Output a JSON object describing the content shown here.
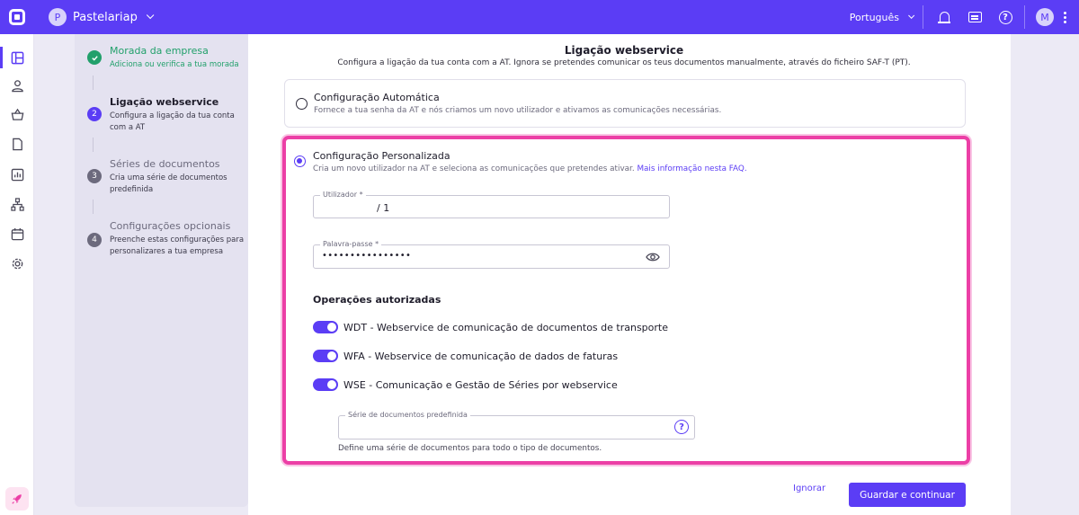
{
  "header": {
    "company_initial": "P",
    "company_name": "Pastelariap",
    "language": "Português",
    "user_initial": "M",
    "icons": [
      "app-logo",
      "bell-icon",
      "chat-icon",
      "help-icon",
      "more-vertical-icon"
    ]
  },
  "sidebar": {
    "icons": [
      "dashboard-icon",
      "user-icon",
      "basket-icon",
      "document-icon",
      "chart-icon",
      "sitemap-icon",
      "calendar-icon",
      "settings-icon",
      "rocket-icon"
    ]
  },
  "steps": [
    {
      "number": "",
      "title": "Morada da empresa",
      "description": "Adiciona ou verifica a tua morada",
      "state": "done"
    },
    {
      "number": "2",
      "title": "Ligação webservice",
      "description": "Configura a ligação da tua conta com a AT",
      "state": "current"
    },
    {
      "number": "3",
      "title": "Séries de documentos",
      "description": "Cria uma série de documentos predefinida",
      "state": "pending"
    },
    {
      "number": "4",
      "title": "Configurações opcionais",
      "description": "Preenche estas configurações para personalizares a tua empresa",
      "state": "pending"
    }
  ],
  "main": {
    "title": "Ligação webservice",
    "subtitle": "Configura a ligação da tua conta com a AT. Ignora se pretendes comunicar os teus documentos manualmente, através do ficheiro SAF-T (PT).",
    "auto": {
      "title": "Configuração Automática",
      "description": "Fornece a tua senha da AT e nós criamos um novo utilizador e ativamos as comunicações necessárias."
    },
    "custom": {
      "title": "Configuração Personalizada",
      "description": "Cria um novo utilizador na AT e seleciona as comunicações que pretendes ativar. ",
      "faq_link": "Mais informação nesta FAQ.",
      "user_label": "Utilizador *",
      "user_value": "/  1",
      "password_label": "Palavra-passe *",
      "password_value": "••••••••••••••••",
      "ops_title": "Operações autorizadas",
      "toggles": [
        {
          "label": "WDT - Webservice de comunicação de documentos de transporte",
          "on": true
        },
        {
          "label": "WFA - Webservice de comunicação de dados de faturas",
          "on": true
        },
        {
          "label": "WSE - Comunicação e Gestão de Séries por webservice",
          "on": true
        }
      ],
      "series_label": "Série de documentos predefinida",
      "series_value": "",
      "series_helper": "Define uma série de documentos para todo o tipo de documentos."
    },
    "ignore_label": "Ignorar",
    "save_label": "Guardar e continuar"
  },
  "colors": {
    "primary": "#5b3df5",
    "highlight": "#ec3fa6",
    "success": "#22a06b",
    "pending": "#6c6a7d"
  }
}
